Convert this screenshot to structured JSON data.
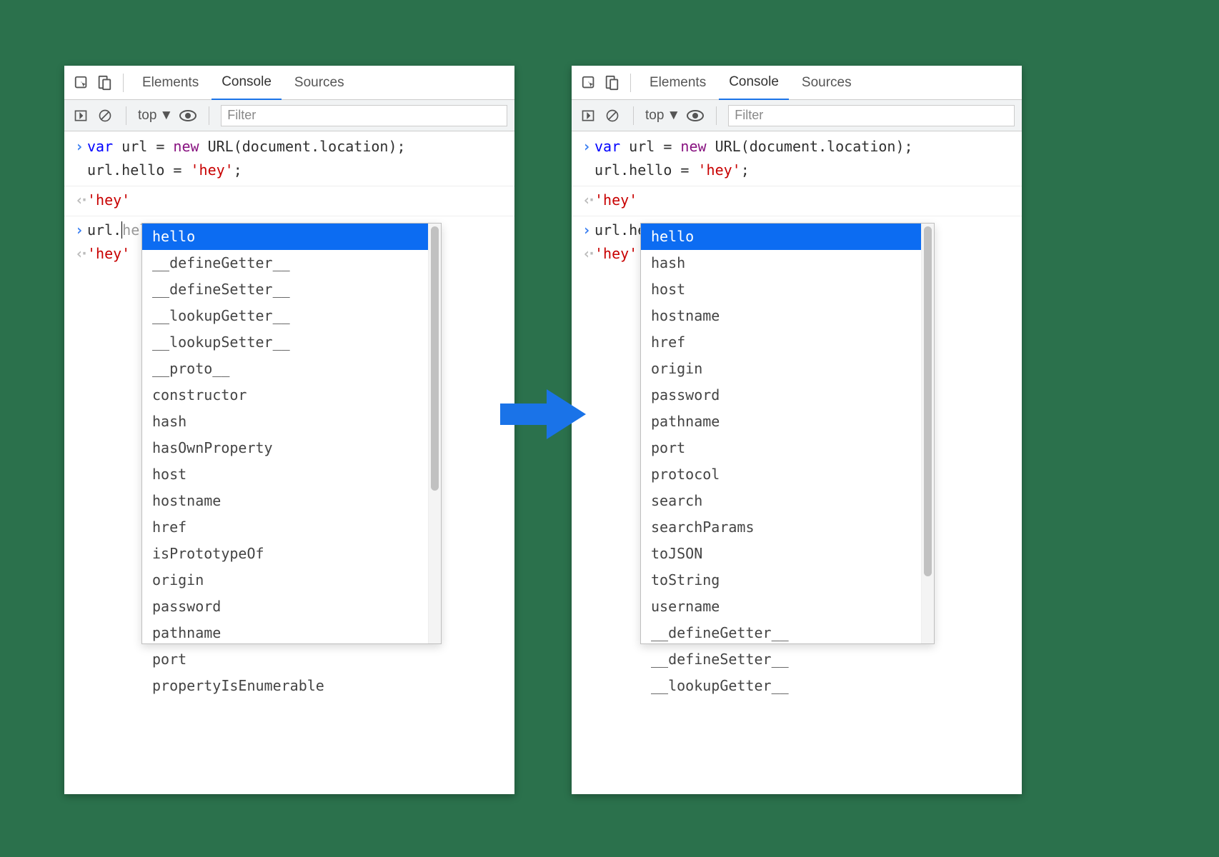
{
  "tabs": {
    "elements": "Elements",
    "console": "Console",
    "sources": "Sources"
  },
  "toolbar": {
    "context": "top",
    "filter_placeholder": "Filter"
  },
  "code": {
    "line1a": "var",
    "line1b": " url = ",
    "line1c": "new",
    "line1d": " URL(document.location);",
    "line2": "url.hello = ",
    "line2s": "'hey'",
    "line2e": ";",
    "out1": "'hey'",
    "left_prompt_pre": "url.",
    "left_prompt_suf": "hello",
    "right_prompt": "url.hello",
    "out2": "'hey'"
  },
  "autocomplete_left": [
    "hello",
    "__defineGetter__",
    "__defineSetter__",
    "__lookupGetter__",
    "__lookupSetter__",
    "__proto__",
    "constructor",
    "hash",
    "hasOwnProperty",
    "host",
    "hostname",
    "href",
    "isPrototypeOf",
    "origin",
    "password",
    "pathname",
    "port",
    "propertyIsEnumerable"
  ],
  "autocomplete_right": [
    "hello",
    "hash",
    "host",
    "hostname",
    "href",
    "origin",
    "password",
    "pathname",
    "port",
    "protocol",
    "search",
    "searchParams",
    "toJSON",
    "toString",
    "username",
    "__defineGetter__",
    "__defineSetter__",
    "__lookupGetter__"
  ]
}
